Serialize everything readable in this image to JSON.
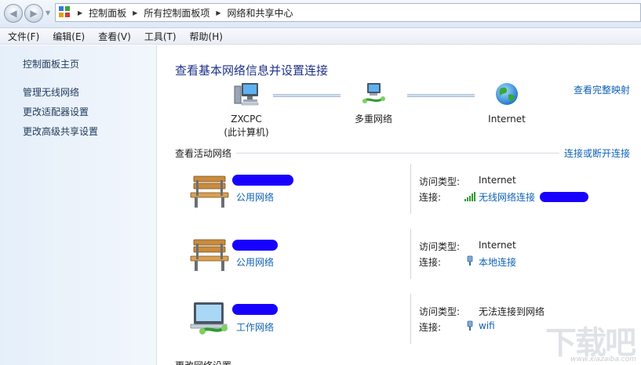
{
  "nav": {
    "back_icon": "back-arrow-icon",
    "forward_icon": "forward-arrow-icon",
    "breadcrumbs": [
      "控制面板",
      "所有控制面板项",
      "网络和共享中心"
    ]
  },
  "menu": [
    "文件(F)",
    "编辑(E)",
    "查看(V)",
    "工具(T)",
    "帮助(H)"
  ],
  "sidebar": {
    "home": "控制面板主页",
    "links": [
      "管理无线网络",
      "更改适配器设置",
      "更改高级共享设置"
    ]
  },
  "main": {
    "title": "查看基本网络信息并设置连接",
    "full_map_link": "查看完整映射",
    "map": {
      "computer": {
        "name": "ZXCPC",
        "sub": "(此计算机)"
      },
      "middle": {
        "name": "多重网络"
      },
      "internet": {
        "name": "Internet"
      }
    },
    "active_label": "查看活动网络",
    "connect_link": "连接或断开连接",
    "access_label": "访问类型:",
    "conn_label": "连接:",
    "networks": [
      {
        "icon": "park-bench-icon",
        "type": "公用网络",
        "access": "Internet",
        "conn_icon": "wifi-signal-icon",
        "conn": "无线网络连接"
      },
      {
        "icon": "park-bench-icon",
        "type": "公用网络",
        "access": "Internet",
        "conn_icon": "ethernet-plug-icon",
        "conn": "本地连接"
      },
      {
        "icon": "work-computer-icon",
        "type": "工作网络",
        "access": "无法连接到网络",
        "conn_icon": "ethernet-plug-icon",
        "conn": "wifi"
      }
    ],
    "bottom_cut": "更改网络设置"
  },
  "watermark": {
    "big": "下载吧",
    "url": "www.xiazaiba.com"
  },
  "colors": {
    "link": "#0f62b5",
    "title": "#1e3287",
    "redaction": "#1800ff"
  }
}
